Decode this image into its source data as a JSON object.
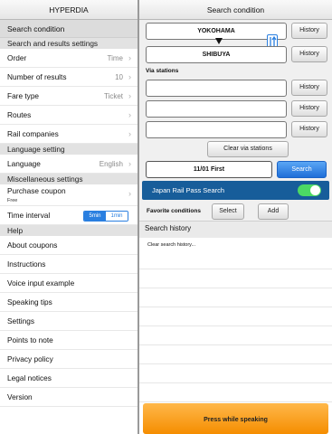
{
  "left": {
    "app_title": "HYPERDIA",
    "search_condition": "Search condition",
    "sections": {
      "search_settings": "Search and results settings",
      "language_setting": "Language setting",
      "misc_settings": "Miscellaneous settings",
      "help": "Help"
    },
    "settings": {
      "order": {
        "label": "Order",
        "value": "Time"
      },
      "results": {
        "label": "Number of results",
        "value": "10"
      },
      "fare": {
        "label": "Fare type",
        "value": "Ticket"
      },
      "routes": {
        "label": "Routes"
      },
      "rail": {
        "label": "Rail companies"
      },
      "language": {
        "label": "Language",
        "value": "English"
      }
    },
    "misc": {
      "purchase_coupon": "Purchase coupon",
      "purchase_coupon_sub": "Free",
      "time_interval": "Time interval",
      "interval_opt1": "5min",
      "interval_opt2": "1min"
    },
    "help_items": [
      "About coupons",
      "Instructions",
      "Voice input example",
      "Speaking tips",
      "Settings",
      "Points to note",
      "Privacy policy",
      "Legal notices",
      "Version"
    ]
  },
  "right": {
    "title": "Search condition",
    "from_station": "YOKOHAMA",
    "to_station": "SHIBUYA",
    "history_label": "History",
    "via_label": "Via stations",
    "clear_via": "Clear via stations",
    "date_value": "11/01 First",
    "search_label": "Search",
    "jr_pass_label": "Japan Rail Pass Search",
    "jr_pass_on": true,
    "favorite_label": "Favorite conditions",
    "select_label": "Select",
    "add_label": "Add",
    "search_history_label": "Search history",
    "clear_history": "Clear search history...",
    "speak_label": "Press while speaking"
  },
  "colors": {
    "accent_blue": "#2a7fe0",
    "jr_bar": "#175d9a",
    "toggle_on": "#4cd964",
    "speak_orange": "#f58d00"
  },
  "icons": {
    "row_chevron": "chevron-right-icon",
    "swap": "swap-stations-icon",
    "direction": "arrow-down-icon"
  }
}
